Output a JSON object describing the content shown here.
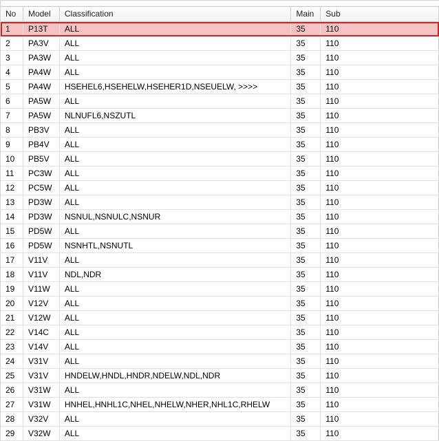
{
  "columns": {
    "no": "No",
    "model": "Model",
    "classification": "Classification",
    "main": "Main",
    "sub": "Sub"
  },
  "rows": [
    {
      "no": "1",
      "model": "P13T",
      "classification": "ALL",
      "main": "35",
      "sub": "110"
    },
    {
      "no": "2",
      "model": "PA3V",
      "classification": "ALL",
      "main": "35",
      "sub": "110"
    },
    {
      "no": "3",
      "model": "PA3W",
      "classification": "ALL",
      "main": "35",
      "sub": "110"
    },
    {
      "no": "4",
      "model": "PA4W",
      "classification": "ALL",
      "main": "35",
      "sub": "110"
    },
    {
      "no": "5",
      "model": "PA4W",
      "classification": "HSEHEL6,HSEHELW,HSEHER1D,NSEUELW,  >>>>",
      "main": "35",
      "sub": "110"
    },
    {
      "no": "6",
      "model": "PA5W",
      "classification": "ALL",
      "main": "35",
      "sub": "110"
    },
    {
      "no": "7",
      "model": "PA5W",
      "classification": "NLNUFL6,NSZUTL",
      "main": "35",
      "sub": "110"
    },
    {
      "no": "8",
      "model": "PB3V",
      "classification": "ALL",
      "main": "35",
      "sub": "110"
    },
    {
      "no": "9",
      "model": "PB4V",
      "classification": "ALL",
      "main": "35",
      "sub": "110"
    },
    {
      "no": "10",
      "model": "PB5V",
      "classification": "ALL",
      "main": "35",
      "sub": "110"
    },
    {
      "no": "11",
      "model": "PC3W",
      "classification": "ALL",
      "main": "35",
      "sub": "110"
    },
    {
      "no": "12",
      "model": "PC5W",
      "classification": "ALL",
      "main": "35",
      "sub": "110"
    },
    {
      "no": "13",
      "model": "PD3W",
      "classification": "ALL",
      "main": "35",
      "sub": "110"
    },
    {
      "no": "14",
      "model": "PD3W",
      "classification": "NSNUL,NSNULC,NSNUR",
      "main": "35",
      "sub": "110"
    },
    {
      "no": "15",
      "model": "PD5W",
      "classification": "ALL",
      "main": "35",
      "sub": "110"
    },
    {
      "no": "16",
      "model": "PD5W",
      "classification": "NSNHTL,NSNUTL",
      "main": "35",
      "sub": "110"
    },
    {
      "no": "17",
      "model": "V11V",
      "classification": "ALL",
      "main": "35",
      "sub": "110"
    },
    {
      "no": "18",
      "model": "V11V",
      "classification": "NDL,NDR",
      "main": "35",
      "sub": "110"
    },
    {
      "no": "19",
      "model": "V11W",
      "classification": "ALL",
      "main": "35",
      "sub": "110"
    },
    {
      "no": "20",
      "model": "V12V",
      "classification": "ALL",
      "main": "35",
      "sub": "110"
    },
    {
      "no": "21",
      "model": "V12W",
      "classification": "ALL",
      "main": "35",
      "sub": "110"
    },
    {
      "no": "22",
      "model": "V14C",
      "classification": "ALL",
      "main": "35",
      "sub": "110"
    },
    {
      "no": "23",
      "model": "V14V",
      "classification": "ALL",
      "main": "35",
      "sub": "110"
    },
    {
      "no": "24",
      "model": "V31V",
      "classification": "ALL",
      "main": "35",
      "sub": "110"
    },
    {
      "no": "25",
      "model": "V31V",
      "classification": "HNDELW,HNDL,HNDR,NDELW,NDL,NDR",
      "main": "35",
      "sub": "110"
    },
    {
      "no": "26",
      "model": "V31W",
      "classification": "ALL",
      "main": "35",
      "sub": "110"
    },
    {
      "no": "27",
      "model": "V31W",
      "classification": "HNHEL,HNHL1C,NHEL,NHELW,NHER,NHL1C,RHELW",
      "main": "35",
      "sub": "110"
    },
    {
      "no": "28",
      "model": "V32V",
      "classification": "ALL",
      "main": "35",
      "sub": "110"
    },
    {
      "no": "29",
      "model": "V32W",
      "classification": "ALL",
      "main": "35",
      "sub": "110"
    }
  ],
  "selected_row": "1",
  "colors": {
    "selected_fill": "#f7c2c2",
    "selected_border": "#c62828"
  }
}
